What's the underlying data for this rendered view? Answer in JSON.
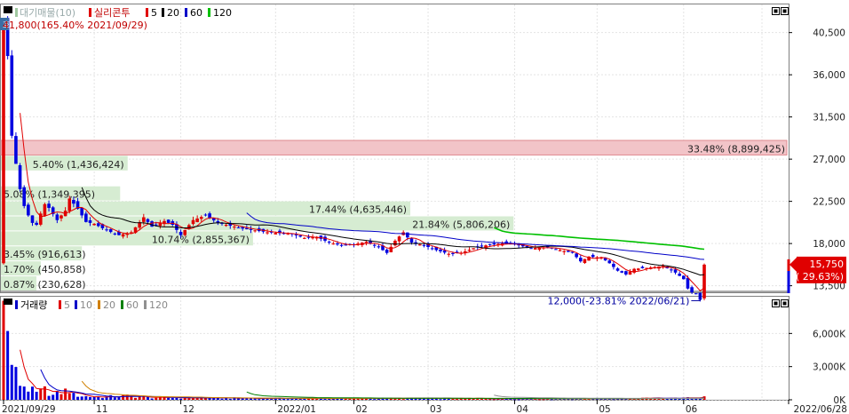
{
  "header": {
    "series_label": "대기매물(10)",
    "symbol": "실리콘투",
    "ma_list": [
      {
        "label": "5",
        "color": "#e00000"
      },
      {
        "label": "20",
        "color": "#000000"
      },
      {
        "label": "60",
        "color": "#0000c8"
      },
      {
        "label": "120",
        "color": "#00c000"
      }
    ],
    "high_note": "41,800(165.40% 2021/09/29)",
    "window_icon_labels": [
      "restore-icon",
      "close-icon"
    ]
  },
  "volume_header": {
    "title": "거래량",
    "ma_list": [
      {
        "label": "5",
        "color": "#e00000"
      },
      {
        "label": "10",
        "color": "#0000c8"
      },
      {
        "label": "20",
        "color": "#d08000"
      },
      {
        "label": "60",
        "color": "#008000"
      },
      {
        "label": "120",
        "color": "#909090"
      }
    ]
  },
  "chart_data": [
    {
      "type": "candlestick",
      "title": "",
      "ylim": [
        12800,
        43500
      ],
      "yticks": [
        {
          "value": 40500,
          "label": "40,500"
        },
        {
          "value": 36000,
          "label": "36,000"
        },
        {
          "value": 31500,
          "label": "31,500"
        },
        {
          "value": 27000,
          "label": "27,000"
        },
        {
          "value": 22500,
          "label": "22,500"
        },
        {
          "value": 18000,
          "label": "18,000"
        },
        {
          "value": 13500,
          "label": "13,500"
        }
      ],
      "x_dates": [
        {
          "index": 0,
          "label": "2021/09/29"
        },
        {
          "index": 22,
          "label": "11"
        },
        {
          "index": 43,
          "label": "12"
        },
        {
          "index": 66,
          "label": "2022/01"
        },
        {
          "index": 85,
          "label": "02"
        },
        {
          "index": 103,
          "label": "03"
        },
        {
          "index": 124,
          "label": "04"
        },
        {
          "index": 144,
          "label": "05"
        },
        {
          "index": 165,
          "label": "06"
        },
        {
          "index": 184,
          "label": "2022/06/28"
        }
      ],
      "bar_count": 185,
      "anchors": [
        [
          0,
          41800
        ],
        [
          1,
          38000
        ],
        [
          2,
          29500
        ],
        [
          3,
          26500
        ],
        [
          4,
          23800
        ],
        [
          5,
          22000
        ],
        [
          6,
          21000
        ],
        [
          7,
          20200
        ],
        [
          8,
          20000
        ],
        [
          9,
          21200
        ],
        [
          10,
          22200
        ],
        [
          11,
          21800
        ],
        [
          13,
          20500
        ],
        [
          15,
          21500
        ],
        [
          16,
          22800
        ],
        [
          18,
          21700
        ],
        [
          20,
          20300
        ],
        [
          22,
          20100
        ],
        [
          25,
          19400
        ],
        [
          28,
          18900
        ],
        [
          31,
          19200
        ],
        [
          34,
          20800
        ],
        [
          36,
          19800
        ],
        [
          39,
          20400
        ],
        [
          41,
          20000
        ],
        [
          43,
          18900
        ],
        [
          46,
          20500
        ],
        [
          49,
          21000
        ],
        [
          52,
          20200
        ],
        [
          55,
          19900
        ],
        [
          58,
          19600
        ],
        [
          61,
          19400
        ],
        [
          64,
          19200
        ],
        [
          67,
          19100
        ],
        [
          70,
          19000
        ],
        [
          73,
          18600
        ],
        [
          76,
          18700
        ],
        [
          79,
          18100
        ],
        [
          82,
          17800
        ],
        [
          85,
          17900
        ],
        [
          88,
          18200
        ],
        [
          91,
          17600
        ],
        [
          93,
          17000
        ],
        [
          95,
          18300
        ],
        [
          97,
          19200
        ],
        [
          99,
          18100
        ],
        [
          102,
          17800
        ],
        [
          105,
          17300
        ],
        [
          108,
          16900
        ],
        [
          111,
          17000
        ],
        [
          114,
          17500
        ],
        [
          117,
          17800
        ],
        [
          121,
          18000
        ],
        [
          124,
          17900
        ],
        [
          128,
          17500
        ],
        [
          132,
          17600
        ],
        [
          135,
          17300
        ],
        [
          138,
          17000
        ],
        [
          140,
          16100
        ],
        [
          142,
          16600
        ],
        [
          145,
          16500
        ],
        [
          147,
          15900
        ],
        [
          149,
          15100
        ],
        [
          151,
          14700
        ],
        [
          153,
          15300
        ],
        [
          156,
          15400
        ],
        [
          160,
          15600
        ],
        [
          163,
          14900
        ],
        [
          165,
          14200
        ],
        [
          166,
          13200
        ],
        [
          167,
          12800
        ],
        [
          168,
          12600
        ],
        [
          169,
          12000
        ],
        [
          170,
          15750
        ]
      ],
      "moving_averages": [
        {
          "period": "5",
          "color": "#e00000"
        },
        {
          "period": "20",
          "color": "#000000"
        },
        {
          "period": "60",
          "color": "#0000c8"
        },
        {
          "period": "120",
          "color": "#00c000"
        }
      ],
      "volume_profile": [
        {
          "label": "33.48% (8,899,425)",
          "lo": 27350,
          "hi": 29000,
          "highlight": true,
          "text_anchor": "end"
        },
        {
          "label": "5.40% (1,436,424)",
          "lo": 25700,
          "hi": 27350,
          "highlight": false
        },
        {
          "label": "5.08% (1,349,395)",
          "lo": 22500,
          "hi": 24100,
          "highlight": false
        },
        {
          "label": "17.44% (4,635,446)",
          "lo": 20900,
          "hi": 22500,
          "highlight": false
        },
        {
          "label": "21.84% (5,806,206)",
          "lo": 19300,
          "hi": 20900,
          "highlight": false
        },
        {
          "label": "10.74% (2,855,367)",
          "lo": 17700,
          "hi": 19300,
          "highlight": false
        },
        {
          "label": "3.45% (916,613)",
          "lo": 16100,
          "hi": 17700,
          "highlight": false
        },
        {
          "label": "1.70% (450,858)",
          "lo": 14500,
          "hi": 16100,
          "highlight": false
        },
        {
          "label": "0.87% (230,628)",
          "lo": 12900,
          "hi": 14500,
          "highlight": false
        }
      ],
      "reference_line": 12900,
      "low_note": "12,000(-23.81% 2022/06/21)",
      "current_price": {
        "value": 15750,
        "label": "15,750",
        "change": "( 29.63%)"
      }
    },
    {
      "type": "bar",
      "title": "거래량",
      "ylim": [
        0,
        9000
      ],
      "yticks": [
        {
          "value": 6000,
          "label": "6,000K"
        },
        {
          "value": 3000,
          "label": "3,000K"
        },
        {
          "value": 0,
          "label": "0K"
        }
      ],
      "volume_anchors": [
        [
          0,
          8200
        ],
        [
          1,
          5600
        ],
        [
          2,
          3500
        ],
        [
          3,
          2200
        ],
        [
          4,
          1500
        ],
        [
          5,
          1300
        ],
        [
          6,
          1000
        ],
        [
          8,
          600
        ],
        [
          10,
          900
        ],
        [
          12,
          400
        ],
        [
          14,
          700
        ],
        [
          16,
          900
        ],
        [
          17,
          450
        ],
        [
          20,
          300
        ],
        [
          24,
          250
        ],
        [
          30,
          350
        ],
        [
          36,
          200
        ],
        [
          44,
          180
        ],
        [
          55,
          150
        ],
        [
          70,
          120
        ],
        [
          90,
          130
        ],
        [
          110,
          110
        ],
        [
          130,
          100
        ],
        [
          150,
          120
        ],
        [
          165,
          150
        ],
        [
          168,
          180
        ],
        [
          169,
          250
        ],
        [
          170,
          400
        ]
      ]
    }
  ]
}
